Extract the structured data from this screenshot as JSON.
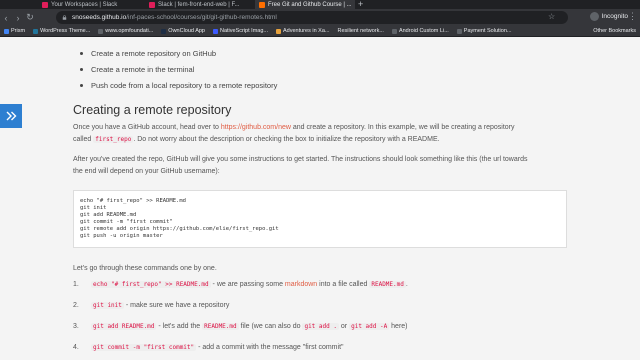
{
  "browser": {
    "tabs": [
      {
        "label": "Your Workspaces | Slack",
        "active": false,
        "color": "#e01e5a"
      },
      {
        "label": "Slack | fem-front-end-web | F...",
        "active": false,
        "color": "#e01e5a"
      },
      {
        "label": "Free Git and Github Course | ...",
        "active": true,
        "color": "#ff6f00"
      }
    ],
    "url_host": "snoseeds.github.io",
    "url_path": "/inf-paces-school/courses/git/git-github-remotes.html",
    "profile_label": "Incognito",
    "bookmarks": [
      {
        "label": "Prism",
        "color": "#4285f4"
      },
      {
        "label": "WordPress Theme...",
        "color": "#21759b"
      },
      {
        "label": "www.opmfoundati...",
        "color": "#5f6368"
      },
      {
        "label": "OwnCloud App",
        "color": "#1d2d44"
      },
      {
        "label": "NativeScript Imag...",
        "color": "#3c5afe"
      },
      {
        "label": "Adventures in Xa...",
        "color": "#e8a33d"
      },
      {
        "label": "Resilient network...",
        "color": "#5f6368"
      },
      {
        "label": "Android Custom Li...",
        "color": "#5f6368"
      },
      {
        "label": "Payment Solution...",
        "color": "#5f6368"
      }
    ],
    "other_bookmarks": "Other Bookmarks"
  },
  "article": {
    "bullets": [
      "Create a remote repository on GitHub",
      "Create a remote in the terminal",
      "Push code from a local repository to a remote repository"
    ],
    "heading": "Creating a remote repository",
    "para1_a": "Once you have a GitHub account, head over to ",
    "para1_link": "https://github.com/new",
    "para1_b": " and create a repository. In this example, we will be creating a repository",
    "para1_c": "called ",
    "para1_code": "first_repo",
    "para1_d": ". Do not worry about the description or checking the box to initialize the repository with a README.",
    "para2_a": "After you've created the repo, GitHub will give you some instructions to get started. The instructions should look something like this (the url towards",
    "para2_b": "the end will depend on your GitHub username):",
    "code_lines": [
      "echo \"# first_repo\" >> README.md",
      "git init",
      "git add README.md",
      "git commit -m \"first commit\"",
      "git remote add origin https://github.com/elie/first_repo.git",
      "git push -u origin master"
    ],
    "para3": "Let's go through these commands one by one.",
    "steps": [
      {
        "num": "1.",
        "code": "echo \"# first_repo\" >> README.md",
        "text_a": " - we are passing some ",
        "link": "markdown",
        "text_b": " into a file called ",
        "code2": "README.md",
        "text_c": "."
      },
      {
        "num": "2.",
        "code": "git init",
        "text_a": " - make sure we have a repository"
      },
      {
        "num": "3.",
        "code": "git add README.md",
        "text_a": " - let's add the ",
        "code2": "README.md",
        "text_b": " file (we can also do ",
        "code3": "git add .",
        "text_c": " or ",
        "code4": "git add -A",
        "text_d": " here)"
      },
      {
        "num": "4.",
        "code": "git commit -m \"first commit\"",
        "text_a": " - add a commit with the message \"first commit\""
      }
    ]
  }
}
